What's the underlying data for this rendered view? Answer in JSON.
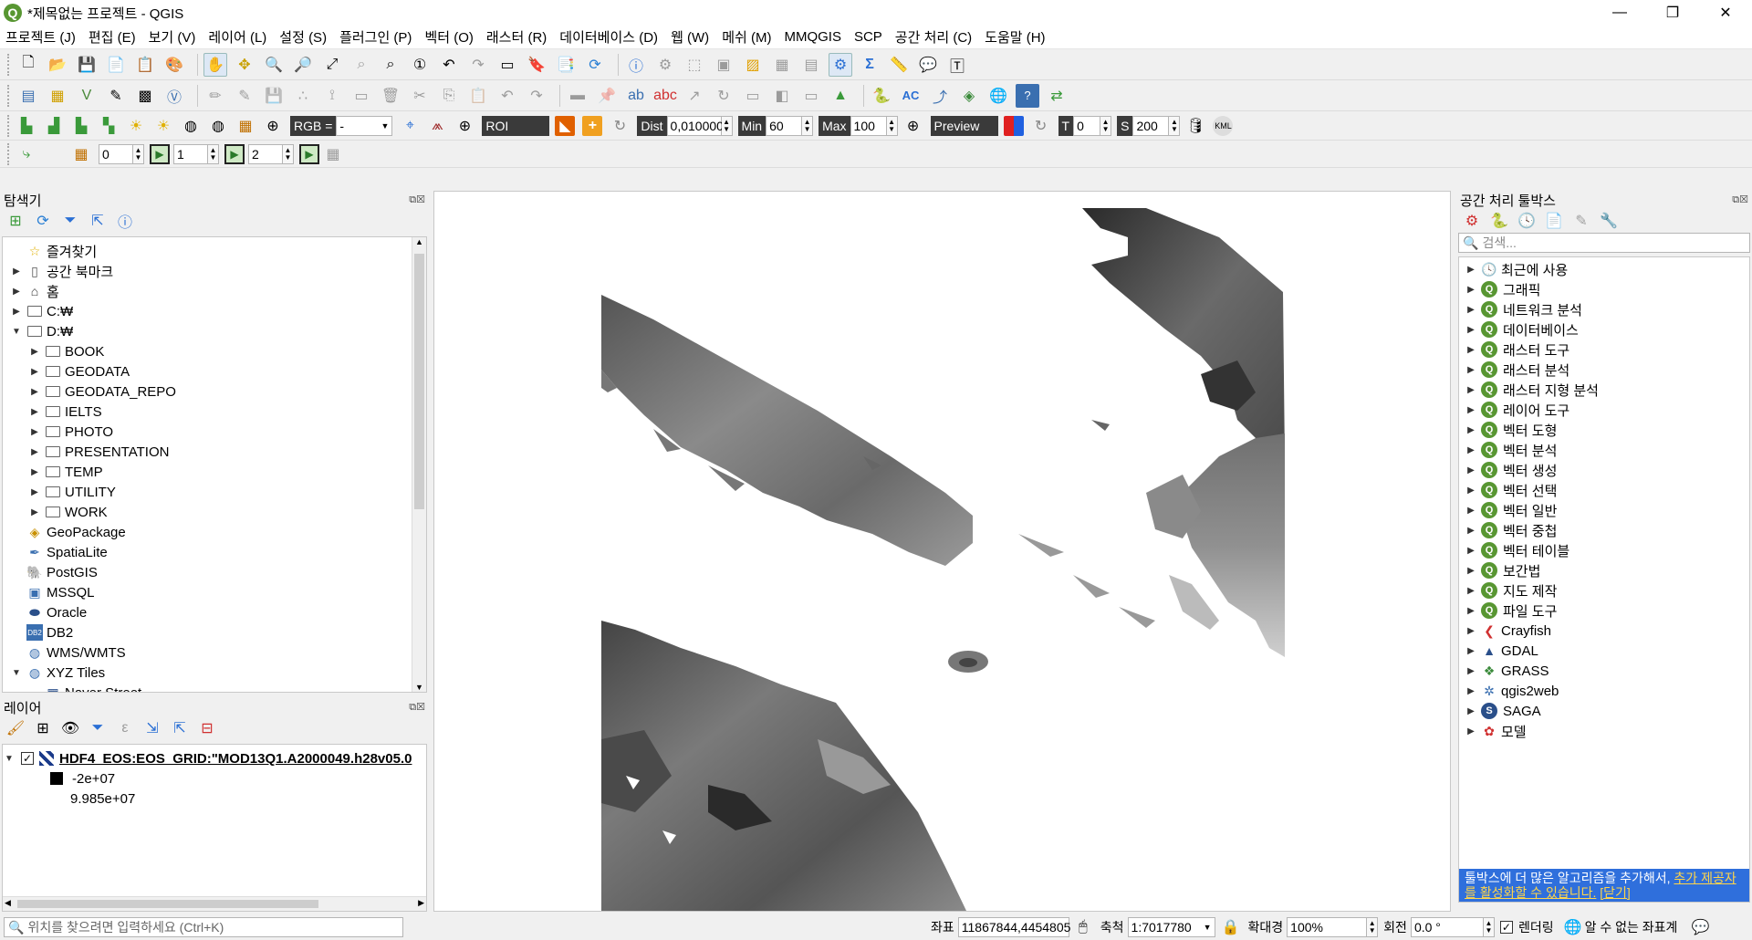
{
  "window": {
    "title": "*제목없는 프로젝트 - QGIS",
    "logo_letter": "Q",
    "min": "—",
    "max": "❐",
    "close": "✕"
  },
  "menu": [
    "프로젝트 (J)",
    "편집 (E)",
    "보기 (V)",
    "레이어 (L)",
    "설정 (S)",
    "플러그인 (P)",
    "벡터 (O)",
    "래스터 (R)",
    "데이터베이스 (D)",
    "웹 (W)",
    "메쉬 (M)",
    "MMQGIS",
    "SCP",
    "공간 처리 (C)",
    "도움말 (H)"
  ],
  "scp": {
    "rgb_label": "RGB =",
    "rgb_value": "-",
    "roi_label": "ROI",
    "dist_label": "Dist",
    "dist_value": "0,010000",
    "min_label": "Min",
    "min_value": "60",
    "max_label": "Max",
    "max_value": "100",
    "preview_label": "Preview",
    "t_label": "T",
    "t_value": "0",
    "s_label": "S",
    "s_value": "200",
    "band0": "0",
    "band1": "1",
    "band2": "2"
  },
  "browser": {
    "title": "탐색기",
    "items": [
      {
        "label": "즐겨찾기",
        "indent": 0,
        "arrow": "",
        "icon": "star"
      },
      {
        "label": "공간 북마크",
        "indent": 0,
        "arrow": "▶",
        "icon": "bookmark"
      },
      {
        "label": "홈",
        "indent": 0,
        "arrow": "▶",
        "icon": "home"
      },
      {
        "label": "C:₩",
        "indent": 0,
        "arrow": "▶",
        "icon": "folder"
      },
      {
        "label": "D:₩",
        "indent": 0,
        "arrow": "▼",
        "icon": "folder"
      },
      {
        "label": "BOOK",
        "indent": 1,
        "arrow": "▶",
        "icon": "folder"
      },
      {
        "label": "GEODATA",
        "indent": 1,
        "arrow": "▶",
        "icon": "folder"
      },
      {
        "label": "GEODATA_REPO",
        "indent": 1,
        "arrow": "▶",
        "icon": "folder"
      },
      {
        "label": "IELTS",
        "indent": 1,
        "arrow": "▶",
        "icon": "folder"
      },
      {
        "label": "PHOTO",
        "indent": 1,
        "arrow": "▶",
        "icon": "folder"
      },
      {
        "label": "PRESENTATION",
        "indent": 1,
        "arrow": "▶",
        "icon": "folder"
      },
      {
        "label": "TEMP",
        "indent": 1,
        "arrow": "▶",
        "icon": "folder"
      },
      {
        "label": "UTILITY",
        "indent": 1,
        "arrow": "▶",
        "icon": "folder"
      },
      {
        "label": "WORK",
        "indent": 1,
        "arrow": "▶",
        "icon": "folder"
      },
      {
        "label": "GeoPackage",
        "indent": 0,
        "arrow": "",
        "icon": "geopackage"
      },
      {
        "label": "SpatiaLite",
        "indent": 0,
        "arrow": "",
        "icon": "spatialite"
      },
      {
        "label": "PostGIS",
        "indent": 0,
        "arrow": "",
        "icon": "postgis"
      },
      {
        "label": "MSSQL",
        "indent": 0,
        "arrow": "",
        "icon": "mssql"
      },
      {
        "label": "Oracle",
        "indent": 0,
        "arrow": "",
        "icon": "oracle"
      },
      {
        "label": "DB2",
        "indent": 0,
        "arrow": "",
        "icon": "db2"
      },
      {
        "label": "WMS/WMTS",
        "indent": 0,
        "arrow": "",
        "icon": "globe"
      },
      {
        "label": "XYZ Tiles",
        "indent": 0,
        "arrow": "▼",
        "icon": "globe"
      },
      {
        "label": "Naver Street",
        "indent": 1,
        "arrow": "",
        "icon": "tiles"
      }
    ]
  },
  "layers": {
    "title": "레이어",
    "layer_name": "HDF4_EOS:EOS_GRID:\"MOD13Q1.A2000049.h28v05.0",
    "legend_min": "-2e+07",
    "legend_max": "9.985e+07"
  },
  "toolbox": {
    "title": "공간 처리 툴박스",
    "search_placeholder": "검색...",
    "items": [
      {
        "label": "최근에 사용",
        "icon": "clock"
      },
      {
        "label": "그래픽",
        "icon": "qgis"
      },
      {
        "label": "네트워크 분석",
        "icon": "qgis"
      },
      {
        "label": "데이터베이스",
        "icon": "qgis"
      },
      {
        "label": "래스터 도구",
        "icon": "qgis"
      },
      {
        "label": "래스터 분석",
        "icon": "qgis"
      },
      {
        "label": "래스터 지형 분석",
        "icon": "qgis"
      },
      {
        "label": "레이어 도구",
        "icon": "qgis"
      },
      {
        "label": "벡터 도형",
        "icon": "qgis"
      },
      {
        "label": "벡터 분석",
        "icon": "qgis"
      },
      {
        "label": "벡터 생성",
        "icon": "qgis"
      },
      {
        "label": "벡터 선택",
        "icon": "qgis"
      },
      {
        "label": "벡터 일반",
        "icon": "qgis"
      },
      {
        "label": "벡터 중첩",
        "icon": "qgis"
      },
      {
        "label": "벡터 테이블",
        "icon": "qgis"
      },
      {
        "label": "보간법",
        "icon": "qgis"
      },
      {
        "label": "지도 제작",
        "icon": "qgis"
      },
      {
        "label": "파일 도구",
        "icon": "qgis"
      },
      {
        "label": "Crayfish",
        "icon": "crayfish"
      },
      {
        "label": "GDAL",
        "icon": "gdal"
      },
      {
        "label": "GRASS",
        "icon": "grass"
      },
      {
        "label": "qgis2web",
        "icon": "qgis2web"
      },
      {
        "label": "SAGA",
        "icon": "saga"
      },
      {
        "label": "모델",
        "icon": "model"
      }
    ],
    "notice_text": "툴박스에 더 많은 알고리즘을 추가해서, ",
    "notice_link": "추가 제공자를 활성화할 수 있습니다.",
    "notice_close": "[닫기]"
  },
  "status": {
    "search_placeholder": "위치를 찾으려면 입력하세요 (Ctrl+K)",
    "coord_label": "좌표",
    "coord_value": "11867844,4454805",
    "scale_label": "축척",
    "scale_value": "1:7017780",
    "magnifier_label": "확대경",
    "magnifier_value": "100%",
    "rotation_label": "회전",
    "rotation_value": "0.0 °",
    "render_label": "렌더링",
    "crs_label": "알 수 없는 좌표계"
  }
}
